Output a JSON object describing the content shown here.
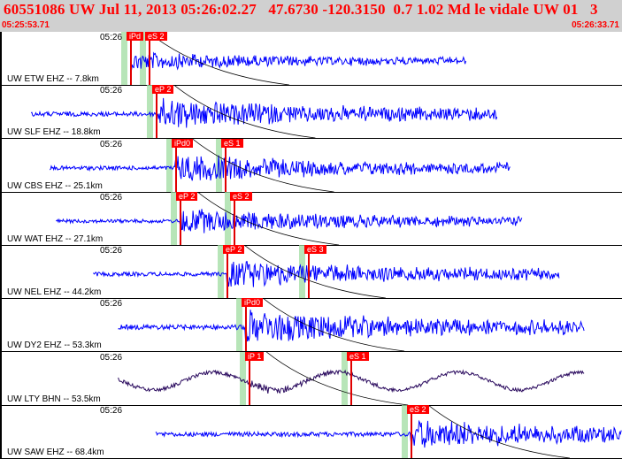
{
  "header": {
    "title": "60551086 UW Jul 11, 2013 05:26:02.27   47.6730 -120.3150  0.7 1.02 Md le vidale UW 01   3",
    "start_time": "05:25:53.71",
    "end_time": "05:26:33.71"
  },
  "colors": {
    "trace": "#0000ff",
    "trace_lty": "#2a0a5e",
    "pick": "#ff0000",
    "window": "#9fdca0",
    "header_bg": "#d0d0d0"
  },
  "traces": [
    {
      "time_label": "05:26",
      "station": "UW ETW EHZ -- 7.8km",
      "picks": [
        {
          "label": "iPd",
          "pos": 0.209
        },
        {
          "label": "eS 2",
          "pos": 0.239
        }
      ],
      "amplitude": 0.3,
      "start": 0.21,
      "end": 0.75,
      "color": "#0000ff"
    },
    {
      "time_label": "05:26",
      "station": "UW SLF EHZ -- 18.8km",
      "picks": [
        {
          "label": "eP 2",
          "pos": 0.251
        }
      ],
      "amplitude": 0.5,
      "start": 0.05,
      "end": 0.8,
      "color": "#0000ff"
    },
    {
      "time_label": "05:26",
      "station": "UW CBS EHZ -- 25.1km",
      "picks": [
        {
          "label": "iPd0",
          "pos": 0.281
        },
        {
          "label": "eS 1",
          "pos": 0.361
        }
      ],
      "amplitude": 0.45,
      "start": 0.08,
      "end": 0.82,
      "color": "#0000ff"
    },
    {
      "time_label": "05:26",
      "station": "UW WAT EHZ -- 27.1km",
      "picks": [
        {
          "label": "eP 2",
          "pos": 0.289
        },
        {
          "label": "eS 2",
          "pos": 0.376
        }
      ],
      "amplitude": 0.4,
      "start": 0.09,
      "end": 0.84,
      "color": "#0000ff"
    },
    {
      "time_label": "05:26",
      "station": "UW NEL EHZ -- 44.2km",
      "picks": [
        {
          "label": "eP 2",
          "pos": 0.364
        },
        {
          "label": "eS 3",
          "pos": 0.495
        }
      ],
      "amplitude": 0.45,
      "start": 0.15,
      "end": 0.9,
      "color": "#0000ff"
    },
    {
      "time_label": "05:26",
      "station": "UW DY2 EHZ -- 53.3km",
      "picks": [
        {
          "label": "iPd0",
          "pos": 0.394
        }
      ],
      "amplitude": 0.55,
      "start": 0.19,
      "end": 0.94,
      "color": "#0000ff"
    },
    {
      "time_label": "05:26",
      "station": "UW LTY BHN -- 53.5km",
      "picks": [
        {
          "label": "iP 1",
          "pos": 0.4
        },
        {
          "label": "eS 1",
          "pos": 0.563
        }
      ],
      "amplitude": 0.35,
      "start": 0.19,
      "end": 0.94,
      "color": "#2a0a5e"
    },
    {
      "time_label": "05:26",
      "station": "UW SAW EHZ -- 68.4km",
      "picks": [
        {
          "label": "eS 2",
          "pos": 0.66
        }
      ],
      "amplitude": 0.5,
      "start": 0.25,
      "end": 1.0,
      "color": "#0000ff"
    }
  ]
}
